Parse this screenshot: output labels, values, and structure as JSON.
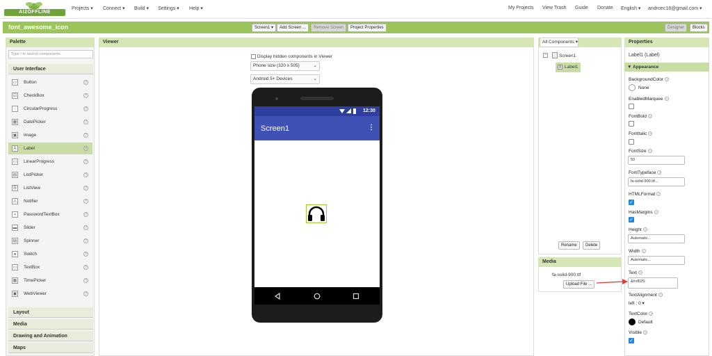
{
  "top": {
    "logo": "AI2OFFLINE",
    "menus": [
      "Projects ▾",
      "Connect ▾",
      "Build ▾",
      "Settings ▾",
      "Help ▾"
    ],
    "right": [
      "My Projects",
      "View Trash",
      "Guide",
      "Donate",
      "English ▾",
      "androec18@gmail.com ▾"
    ]
  },
  "toolbar": {
    "project": "font_awesome_icon",
    "screen_select": "Screen1 ▾",
    "add_screen": "Add Screen ...",
    "remove_screen": "Remove Screen",
    "project_props": "Project Properties",
    "designer": "Designer",
    "blocks": "Blocks"
  },
  "palette": {
    "title": "Palette",
    "search_placeholder": "Type / to search components",
    "category": "User Interface",
    "items": [
      "Button",
      "CheckBox",
      "CircularProgress",
      "DatePicker",
      "Image",
      "Label",
      "LinearProgress",
      "ListPicker",
      "ListView",
      "Notifier",
      "PasswordTextBox",
      "Slider",
      "Spinner",
      "Switch",
      "TextBox",
      "TimePicker",
      "WebViewer"
    ],
    "bottom_categories": [
      "Layout",
      "Media",
      "Drawing and Animation",
      "Maps"
    ],
    "help": "?"
  },
  "viewer": {
    "title": "Viewer",
    "hidden_label": "Display hidden components in Viewer",
    "size": "Phone size (320 x 505)",
    "theme": "Android 5+ Devices",
    "clock": "12:30",
    "screen_title": "Screen1"
  },
  "components": {
    "dropdown": "All Components ▾",
    "root": "Screen1",
    "child": "Label1",
    "rename": "Rename",
    "delete": "Delete"
  },
  "media": {
    "title": "Media",
    "file": "fa-solid-900.ttf",
    "upload": "Upload File ..."
  },
  "properties": {
    "title": "Properties",
    "subtitle": "Label1 (Label)",
    "section": "▼ Appearance",
    "bg_label": "BackgroundColor",
    "bg_value": "None",
    "marquee": "EnabledMarquee",
    "bold": "FontBold",
    "italic": "FontItalic",
    "size_label": "FontSize",
    "size_value": "50",
    "typeface_label": "FontTypeface",
    "typeface_value": "fa-solid-900.ttf...",
    "html": "HTMLFormat",
    "margins": "HasMargins",
    "height_label": "Height",
    "height_value": "Automatic...",
    "width_label": "Width",
    "width_value": "Automatic...",
    "text_label": "Text",
    "text_value": "&#xf025;",
    "align_label": "TextAlignment",
    "align_value": "left : 0 ▾",
    "color_label": "TextColor",
    "color_value": "Default",
    "visible": "Visible"
  }
}
